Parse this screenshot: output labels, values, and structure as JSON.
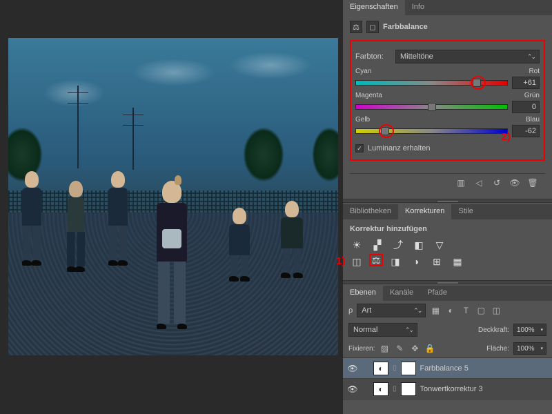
{
  "panels": {
    "properties": {
      "tab_properties": "Eigenschaften",
      "tab_info": "Info",
      "adj_name": "Farbbalance"
    },
    "farbbalance": {
      "tone_label": "Farbton:",
      "tone_value": "Mitteltöne",
      "cyan_label": "Cyan",
      "red_label": "Rot",
      "cyan_red_value": "+61",
      "magenta_label": "Magenta",
      "green_label": "Grün",
      "magenta_green_value": "0",
      "yellow_label": "Gelb",
      "blue_label": "Blau",
      "yellow_blue_value": "-62",
      "preserve_lum": "Luminanz erhalten"
    },
    "libraries": {
      "tab_lib": "Bibliotheken",
      "tab_corr": "Korrekturen",
      "tab_styles": "Stile",
      "add_label": "Korrektur hinzufügen"
    },
    "layers": {
      "tab_layers": "Ebenen",
      "tab_channels": "Kanäle",
      "tab_paths": "Pfade",
      "filter_kind": "Art",
      "blend_mode": "Normal",
      "opacity_label": "Deckkraft:",
      "opacity_value": "100%",
      "lock_label": "Fixieren:",
      "fill_label": "Fläche:",
      "fill_value": "100%",
      "layer1_name": "Farbbalance 5",
      "layer2_name": "Tonwertkorrektur 3"
    }
  },
  "annotations": {
    "one": "1)",
    "two": "2)"
  }
}
